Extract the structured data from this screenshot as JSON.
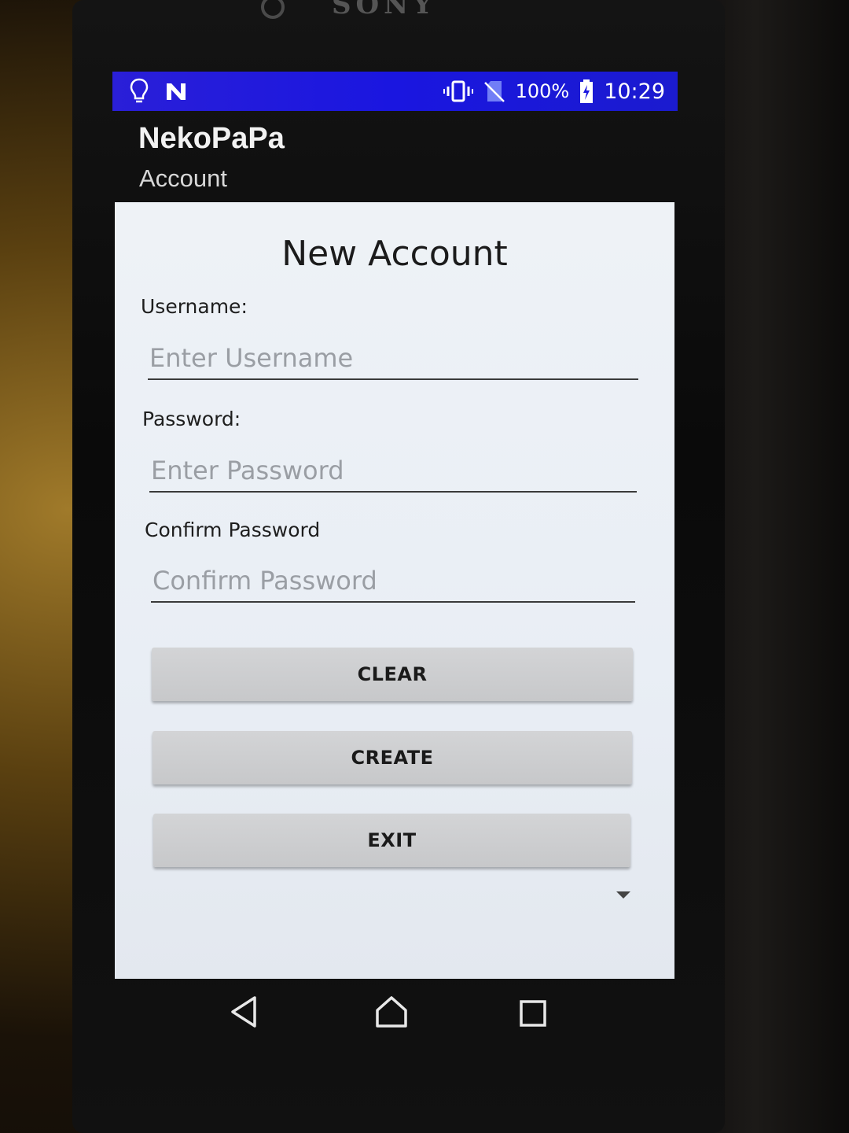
{
  "device": {
    "brand": "SONY"
  },
  "status_bar": {
    "left_icons": [
      "lightbulb-icon",
      "nfc-n-icon"
    ],
    "right_icons": [
      "vibrate-icon",
      "no-sim-icon",
      "battery-charging-icon"
    ],
    "battery": "100%",
    "time": "10:29",
    "color": "#1a16e0"
  },
  "app_bar": {
    "title": "NekoPaPa",
    "subtitle": "Account"
  },
  "form": {
    "title": "New Account",
    "username": {
      "label": "Username:",
      "value": "",
      "placeholder": "Enter Username"
    },
    "password": {
      "label": "Password:",
      "value": "",
      "placeholder": "Enter Password"
    },
    "confirm_password": {
      "label": "Confirm Password",
      "value": "",
      "placeholder": "Confirm Password"
    }
  },
  "buttons": {
    "clear": "CLEAR",
    "create": "CREATE",
    "exit": "EXIT"
  },
  "nav_bar": {
    "items": [
      "back-icon",
      "home-icon",
      "recents-icon"
    ]
  }
}
